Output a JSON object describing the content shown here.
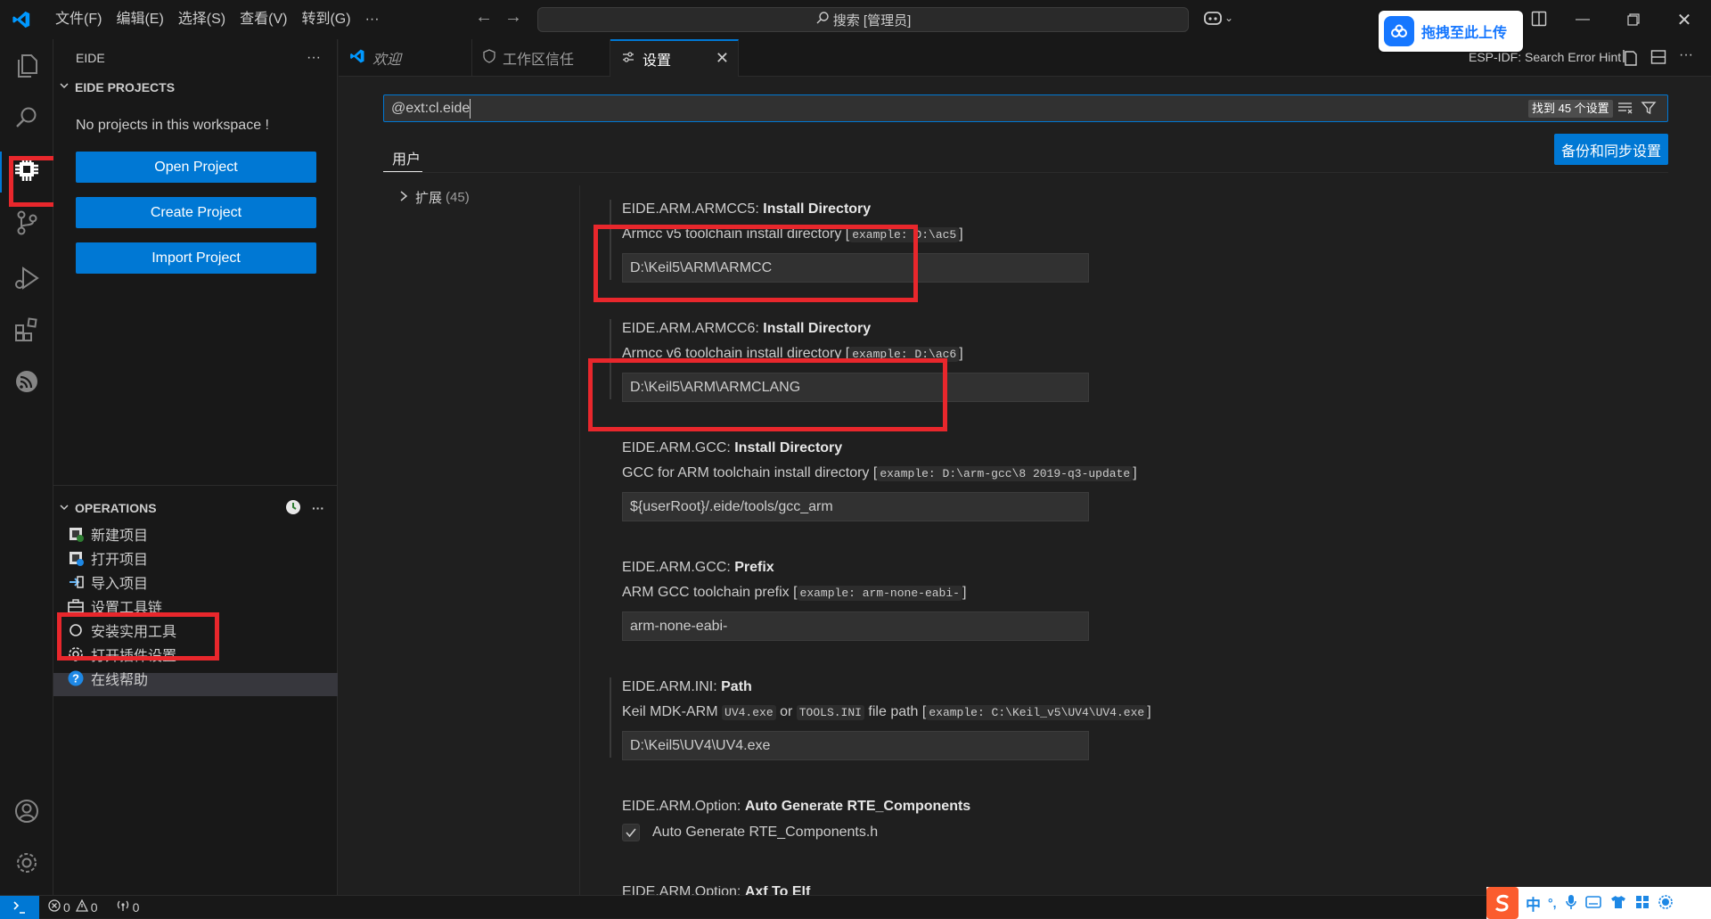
{
  "titlebar": {
    "menus": [
      "文件(F)",
      "编辑(E)",
      "选择(S)",
      "查看(V)",
      "转到(G)",
      "···"
    ],
    "search_text": "搜索 [管理员]",
    "upload_badge": "拖拽至此上传"
  },
  "sidebar": {
    "header": "EIDE",
    "projects_section": "EIDE PROJECTS",
    "empty_message": "No projects in this workspace !",
    "buttons": {
      "open": "Open Project",
      "create": "Create Project",
      "import": "Import Project"
    },
    "operations_section": "OPERATIONS",
    "operations": [
      "新建项目",
      "打开项目",
      "导入项目",
      "设置工具链",
      "安装实用工具",
      "打开插件设置",
      "在线帮助"
    ]
  },
  "tabs": [
    {
      "label": "欢迎"
    },
    {
      "label": "工作区信任"
    },
    {
      "label": "设置"
    }
  ],
  "editor_header": {
    "hint": "ESP-IDF: Search Error Hint"
  },
  "settings": {
    "search_value": "@ext:cl.eide",
    "found_count": "找到 45 个设置",
    "scope_tab": "用户",
    "sync_button": "备份和同步设置",
    "tree_item": "扩展",
    "tree_count": "(45)",
    "items": [
      {
        "prefix": "EIDE.ARM.ARMCC5: ",
        "name": "Install Directory",
        "desc": "Armcc v5 toolchain install directory [",
        "code": "example: D:\\ac5",
        "desc_end": "]",
        "value": "D:\\Keil5\\ARM\\ARMCC"
      },
      {
        "prefix": "EIDE.ARM.ARMCC6: ",
        "name": "Install Directory",
        "desc": "Armcc v6 toolchain install directory [",
        "code": "example: D:\\ac6",
        "desc_end": "]",
        "value": "D:\\Keil5\\ARM\\ARMCLANG"
      },
      {
        "prefix": "EIDE.ARM.GCC: ",
        "name": "Install Directory",
        "desc": "GCC for ARM toolchain install directory [",
        "code": "example: D:\\arm-gcc\\8 2019-q3-update",
        "desc_end": "]",
        "value": "${userRoot}/.eide/tools/gcc_arm"
      },
      {
        "prefix": "EIDE.ARM.GCC: ",
        "name": "Prefix",
        "desc": "ARM GCC toolchain prefix [",
        "code": "example: arm-none-eabi-",
        "desc_end": "]",
        "value": "arm-none-eabi-"
      },
      {
        "prefix": "EIDE.ARM.INI: ",
        "name": "Path",
        "desc": "Keil MDK-ARM ",
        "code": "UV4.exe",
        "desc_mid": " or ",
        "code2": "TOOLS.INI",
        "desc_mid2": " file path [",
        "code3": "example: C:\\Keil_v5\\UV4\\UV4.exe",
        "desc_end": "]",
        "value": "D:\\Keil5\\UV4\\UV4.exe"
      },
      {
        "prefix": "EIDE.ARM.Option: ",
        "name": "Auto Generate RTE_Components",
        "checkbox_label": "Auto Generate RTE_Components.h"
      },
      {
        "prefix": "EIDE.ARM.Option: ",
        "name": "Axf To Elf"
      }
    ]
  },
  "statusbar": {
    "errors": "0",
    "warnings": "0",
    "ports": "0"
  },
  "ime": {
    "lang": "中"
  }
}
